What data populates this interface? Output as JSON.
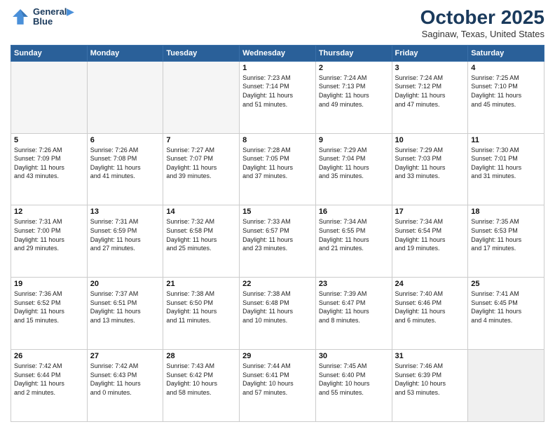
{
  "logo": {
    "line1": "General",
    "line2": "Blue"
  },
  "title": "October 2025",
  "subtitle": "Saginaw, Texas, United States",
  "days_of_week": [
    "Sunday",
    "Monday",
    "Tuesday",
    "Wednesday",
    "Thursday",
    "Friday",
    "Saturday"
  ],
  "weeks": [
    [
      {
        "num": "",
        "info": "",
        "empty": true
      },
      {
        "num": "",
        "info": "",
        "empty": true
      },
      {
        "num": "",
        "info": "",
        "empty": true
      },
      {
        "num": "1",
        "info": "Sunrise: 7:23 AM\nSunset: 7:14 PM\nDaylight: 11 hours\nand 51 minutes."
      },
      {
        "num": "2",
        "info": "Sunrise: 7:24 AM\nSunset: 7:13 PM\nDaylight: 11 hours\nand 49 minutes."
      },
      {
        "num": "3",
        "info": "Sunrise: 7:24 AM\nSunset: 7:12 PM\nDaylight: 11 hours\nand 47 minutes."
      },
      {
        "num": "4",
        "info": "Sunrise: 7:25 AM\nSunset: 7:10 PM\nDaylight: 11 hours\nand 45 minutes."
      }
    ],
    [
      {
        "num": "5",
        "info": "Sunrise: 7:26 AM\nSunset: 7:09 PM\nDaylight: 11 hours\nand 43 minutes."
      },
      {
        "num": "6",
        "info": "Sunrise: 7:26 AM\nSunset: 7:08 PM\nDaylight: 11 hours\nand 41 minutes."
      },
      {
        "num": "7",
        "info": "Sunrise: 7:27 AM\nSunset: 7:07 PM\nDaylight: 11 hours\nand 39 minutes."
      },
      {
        "num": "8",
        "info": "Sunrise: 7:28 AM\nSunset: 7:05 PM\nDaylight: 11 hours\nand 37 minutes."
      },
      {
        "num": "9",
        "info": "Sunrise: 7:29 AM\nSunset: 7:04 PM\nDaylight: 11 hours\nand 35 minutes."
      },
      {
        "num": "10",
        "info": "Sunrise: 7:29 AM\nSunset: 7:03 PM\nDaylight: 11 hours\nand 33 minutes."
      },
      {
        "num": "11",
        "info": "Sunrise: 7:30 AM\nSunset: 7:01 PM\nDaylight: 11 hours\nand 31 minutes."
      }
    ],
    [
      {
        "num": "12",
        "info": "Sunrise: 7:31 AM\nSunset: 7:00 PM\nDaylight: 11 hours\nand 29 minutes."
      },
      {
        "num": "13",
        "info": "Sunrise: 7:31 AM\nSunset: 6:59 PM\nDaylight: 11 hours\nand 27 minutes."
      },
      {
        "num": "14",
        "info": "Sunrise: 7:32 AM\nSunset: 6:58 PM\nDaylight: 11 hours\nand 25 minutes."
      },
      {
        "num": "15",
        "info": "Sunrise: 7:33 AM\nSunset: 6:57 PM\nDaylight: 11 hours\nand 23 minutes."
      },
      {
        "num": "16",
        "info": "Sunrise: 7:34 AM\nSunset: 6:55 PM\nDaylight: 11 hours\nand 21 minutes."
      },
      {
        "num": "17",
        "info": "Sunrise: 7:34 AM\nSunset: 6:54 PM\nDaylight: 11 hours\nand 19 minutes."
      },
      {
        "num": "18",
        "info": "Sunrise: 7:35 AM\nSunset: 6:53 PM\nDaylight: 11 hours\nand 17 minutes."
      }
    ],
    [
      {
        "num": "19",
        "info": "Sunrise: 7:36 AM\nSunset: 6:52 PM\nDaylight: 11 hours\nand 15 minutes."
      },
      {
        "num": "20",
        "info": "Sunrise: 7:37 AM\nSunset: 6:51 PM\nDaylight: 11 hours\nand 13 minutes."
      },
      {
        "num": "21",
        "info": "Sunrise: 7:38 AM\nSunset: 6:50 PM\nDaylight: 11 hours\nand 11 minutes."
      },
      {
        "num": "22",
        "info": "Sunrise: 7:38 AM\nSunset: 6:48 PM\nDaylight: 11 hours\nand 10 minutes."
      },
      {
        "num": "23",
        "info": "Sunrise: 7:39 AM\nSunset: 6:47 PM\nDaylight: 11 hours\nand 8 minutes."
      },
      {
        "num": "24",
        "info": "Sunrise: 7:40 AM\nSunset: 6:46 PM\nDaylight: 11 hours\nand 6 minutes."
      },
      {
        "num": "25",
        "info": "Sunrise: 7:41 AM\nSunset: 6:45 PM\nDaylight: 11 hours\nand 4 minutes."
      }
    ],
    [
      {
        "num": "26",
        "info": "Sunrise: 7:42 AM\nSunset: 6:44 PM\nDaylight: 11 hours\nand 2 minutes."
      },
      {
        "num": "27",
        "info": "Sunrise: 7:42 AM\nSunset: 6:43 PM\nDaylight: 11 hours\nand 0 minutes."
      },
      {
        "num": "28",
        "info": "Sunrise: 7:43 AM\nSunset: 6:42 PM\nDaylight: 10 hours\nand 58 minutes."
      },
      {
        "num": "29",
        "info": "Sunrise: 7:44 AM\nSunset: 6:41 PM\nDaylight: 10 hours\nand 57 minutes."
      },
      {
        "num": "30",
        "info": "Sunrise: 7:45 AM\nSunset: 6:40 PM\nDaylight: 10 hours\nand 55 minutes."
      },
      {
        "num": "31",
        "info": "Sunrise: 7:46 AM\nSunset: 6:39 PM\nDaylight: 10 hours\nand 53 minutes."
      },
      {
        "num": "",
        "info": "",
        "empty": true
      }
    ]
  ]
}
